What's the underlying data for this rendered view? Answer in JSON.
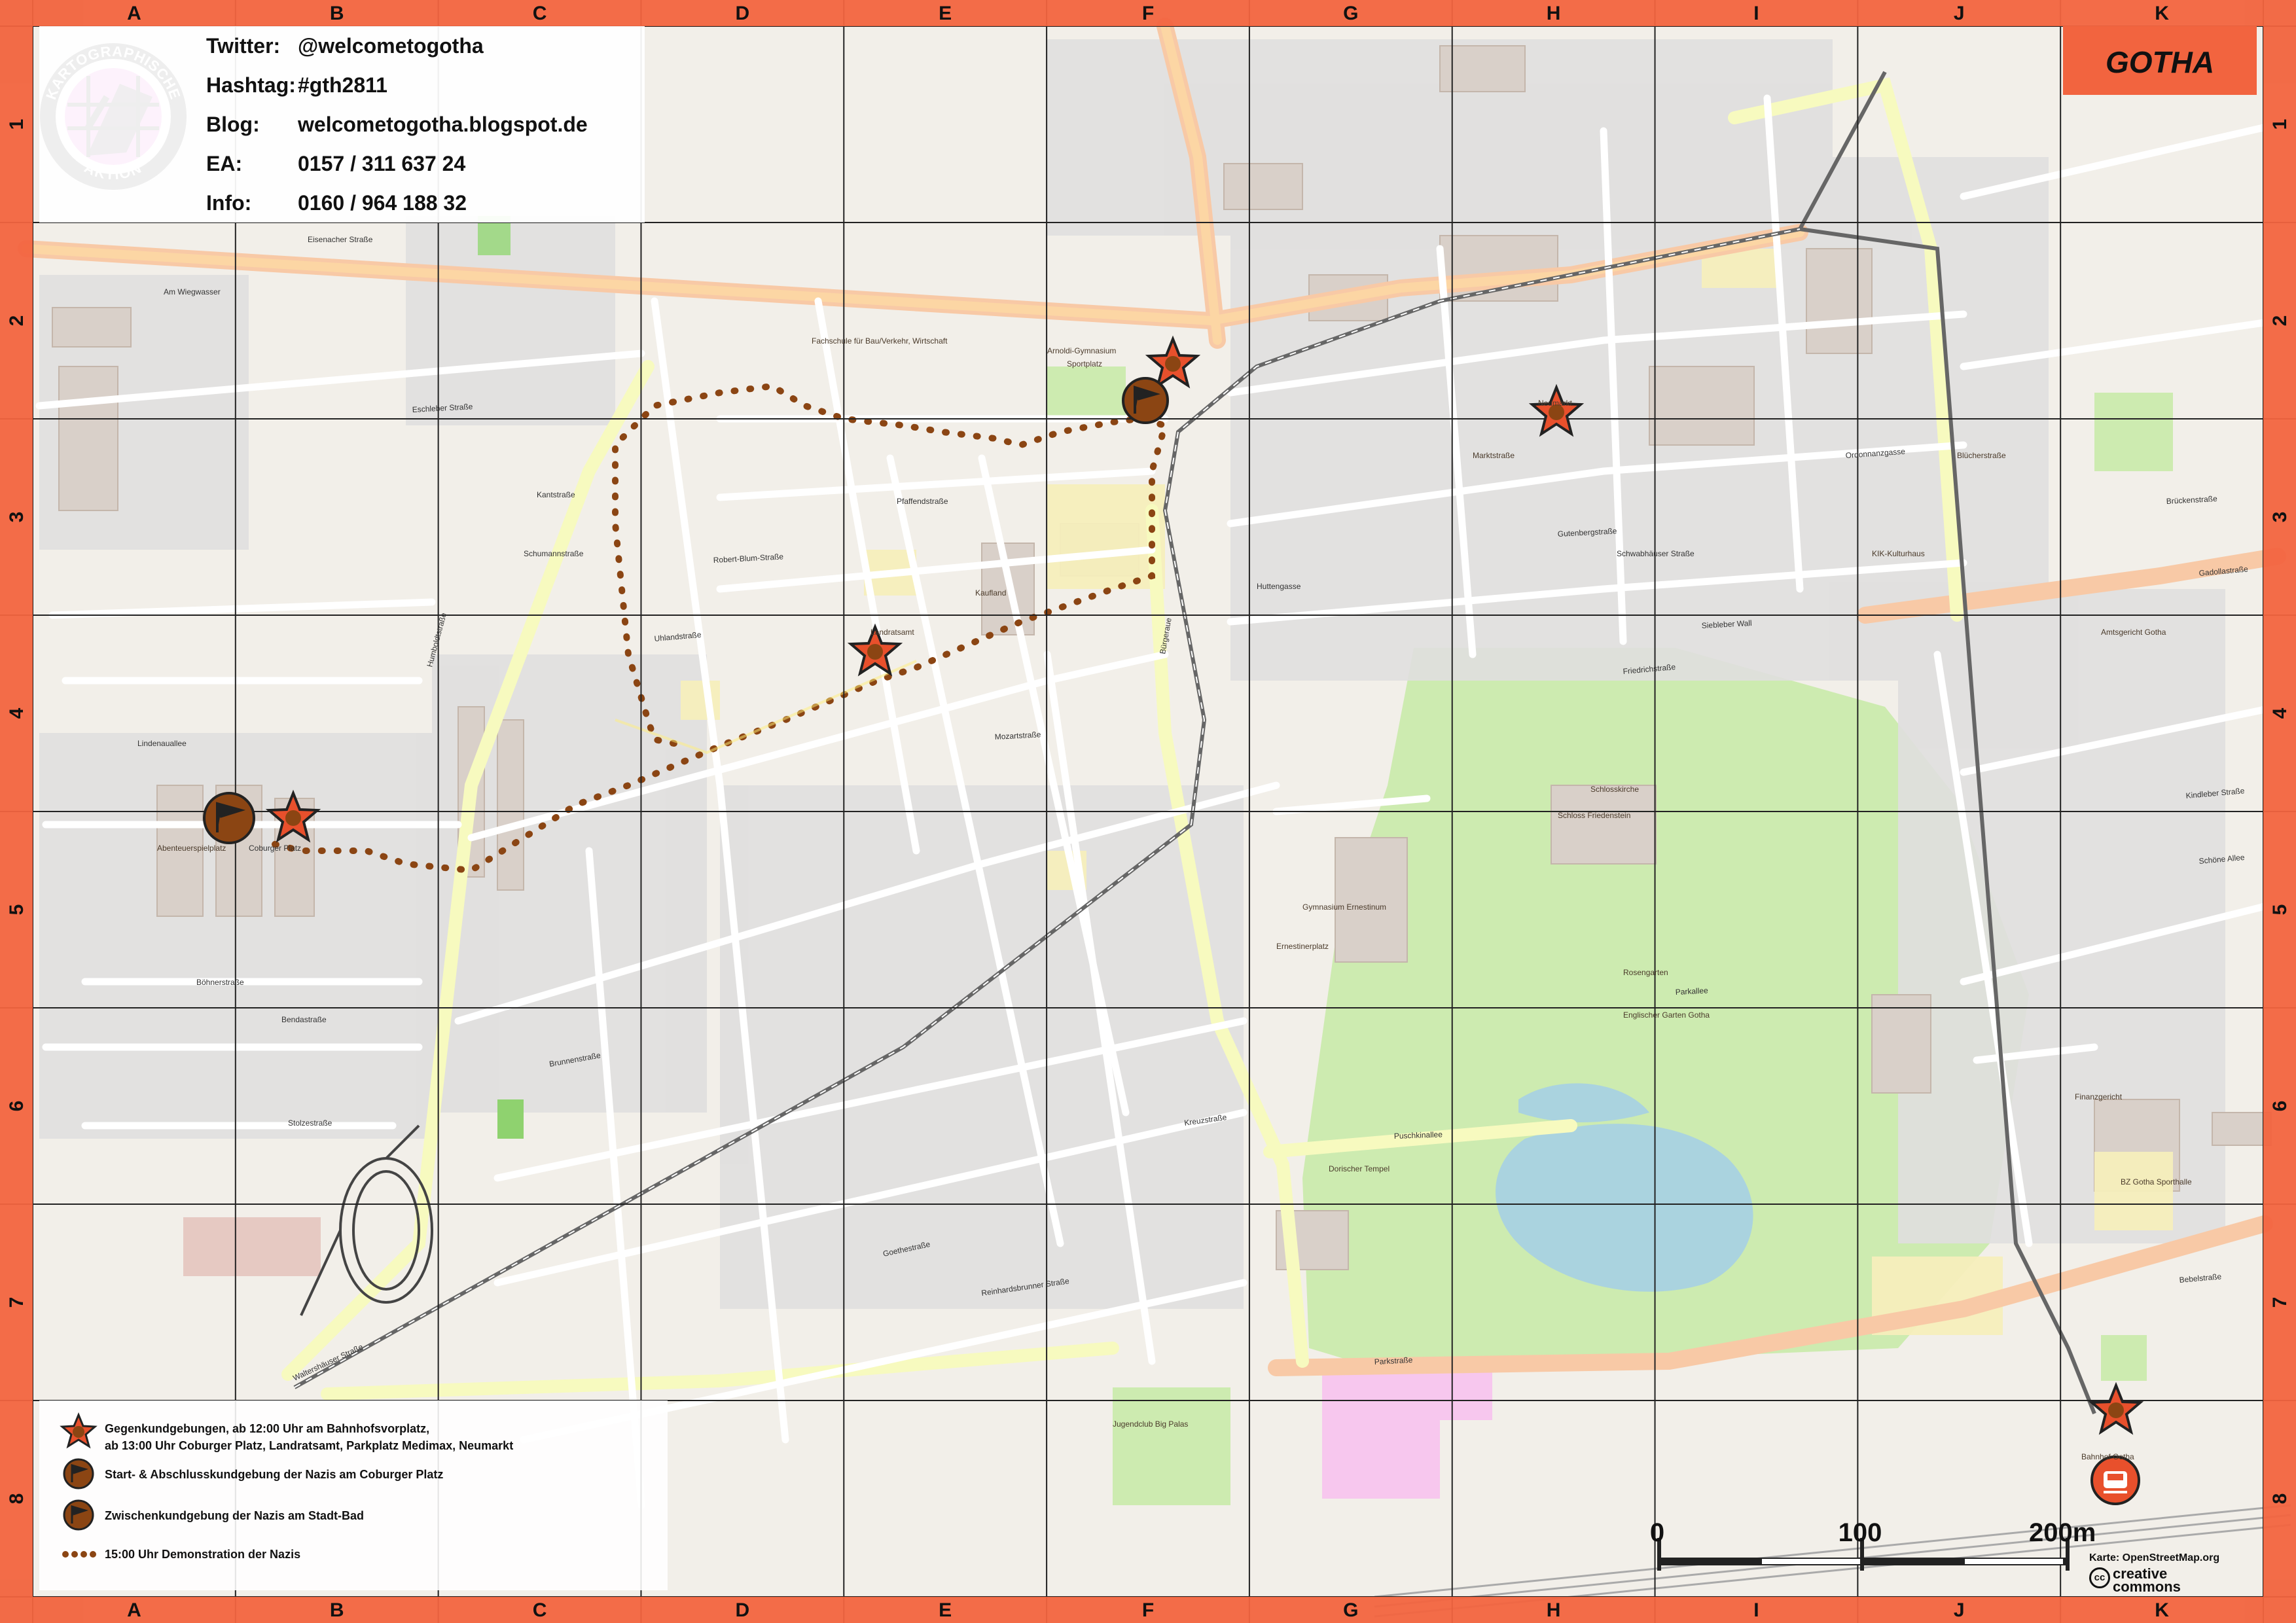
{
  "map": {
    "title": "GOTHA",
    "logo_text_top": "KARTOGRAPHISCHE",
    "logo_text_bottom": "AKTION",
    "info": [
      {
        "label": "Twitter:",
        "value": "@welcometogotha"
      },
      {
        "label": "Hashtag:",
        "value": "#gth2811"
      },
      {
        "label": "Blog:",
        "value": "welcometogotha.blogspot.de"
      },
      {
        "label": "EA:",
        "value": "0157 / 311 637 24"
      },
      {
        "label": "Info:",
        "value": "0160 / 964 188 32"
      }
    ],
    "grid_columns": [
      "A",
      "B",
      "C",
      "D",
      "E",
      "F",
      "G",
      "H",
      "I",
      "J",
      "K"
    ],
    "grid_rows": [
      "1",
      "2",
      "3",
      "4",
      "5",
      "6",
      "7",
      "8"
    ],
    "legend": [
      {
        "icon": "counter-protest-star-icon",
        "text": "Gegenkundgebungen, ab 12:00 Uhr am Bahnhofsvorplatz,\nab 13:00 Uhr Coburger Platz, Landratsamt, Parkplatz Medimax, Neumarkt"
      },
      {
        "icon": "start-rally-flag-icon",
        "text": "Start- & Abschlusskundgebung der Nazis am Coburger Platz"
      },
      {
        "icon": "interim-rally-flag-icon",
        "text": "Zwischenkundgebung der Nazis am Stadt-Bad"
      },
      {
        "icon": "march-route-dots-icon",
        "text": "15:00 Uhr Demonstration der Nazis"
      }
    ],
    "scale": {
      "labels": [
        "0",
        "100",
        "200m"
      ]
    },
    "credit": "Karte: OpenStreetMap.org",
    "license": "creative\ncommons",
    "streets": [
      "Eisenacher Straße",
      "Am Wiegwasser",
      "Eschleber Straße",
      "Kantstraße",
      "Schumannstraße",
      "Robert-Blum-Straße",
      "Uhlandstraße",
      "Pfaffendstraße",
      "Humboldtstraße",
      "Lindenauallee",
      "Coburger Platz",
      "Böhnerstraße",
      "Bendastraße",
      "Stolzestraße",
      "Brunnenstraße",
      "Goethestraße",
      "Reinhardsbrunner Straße",
      "Waltershäuser Straße",
      "Parkstraße",
      "Bebelstraße",
      "Friedrichstraße",
      "Bürgeraue",
      "Huttengasse",
      "Gutenbergstraße",
      "Schwabhäuser Straße",
      "Ordonnanzgasse",
      "Brückenstraße",
      "Parkallee",
      "Puschkinallee",
      "Mozartstraße",
      "Schöne Allee",
      "Kindleber Straße",
      "Gadollastraße",
      "Siebleber Wall",
      "Kreuzstraße"
    ],
    "places": [
      "Englischer Garten Gotha",
      "Schlosskirche",
      "Gymnasium Ernestinum",
      "Landratsamt",
      "Arnoldi-Gymnasium",
      "Sportplatz",
      "Ernestinerplatz",
      "Fachschule für Bau/Verkehr, Wirtschaft",
      "KIK-Kulturhaus",
      "Amtsgericht Gotha",
      "BZ Gotha Sporthalle",
      "Finanzgericht",
      "Jugendclub Big Palas",
      "Abenteuerspielplatz",
      "Neumarkt",
      "Kaufland",
      "Blücherstraße",
      "Rosengarten",
      "Dorischer Tempel",
      "Schloss Friedenstein",
      "Marktstraße",
      "Bahnhof Gotha"
    ],
    "route": {
      "start_label": "Coburger Platz",
      "interim_label": "Stadt-Bad",
      "time": "15:00 Uhr"
    }
  }
}
